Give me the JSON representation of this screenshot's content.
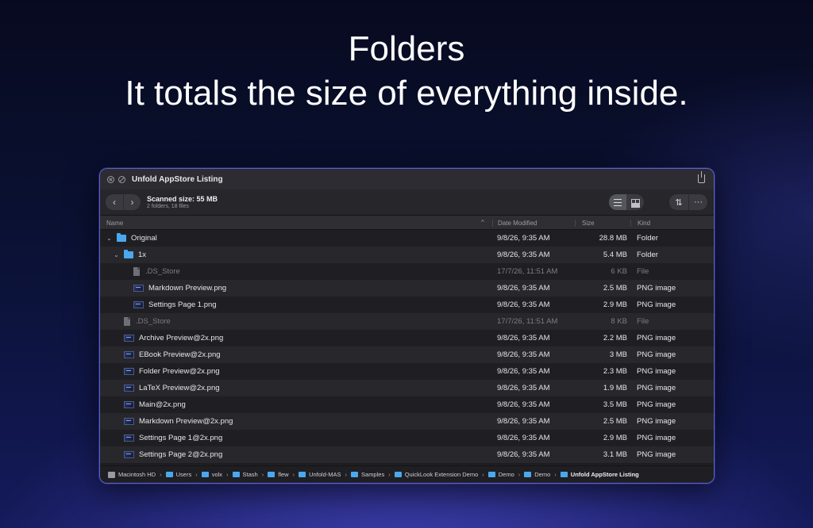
{
  "hero": {
    "line1": "Folders",
    "line2": "It totals the size of everything inside."
  },
  "window": {
    "title": "Unfold AppStore Listing",
    "scanned_size": "Scanned size: 55 MB",
    "scan_summary": "2 folders, 18 files",
    "back_glyph": "‹",
    "forward_glyph": "›",
    "sort_glyph": "⇅",
    "more_glyph": "···"
  },
  "columns": {
    "name": "Name",
    "date": "Date Modified",
    "size": "Size",
    "kind": "Kind",
    "sort_indicator": "^"
  },
  "rows": [
    {
      "name": "Original",
      "date": "9/8/26, 9:35 AM",
      "size": "28.8 MB",
      "kind": "Folder",
      "icon": "folder",
      "level": 0,
      "expanded": true
    },
    {
      "name": "1x",
      "date": "9/8/26, 9:35 AM",
      "size": "5.4 MB",
      "kind": "Folder",
      "icon": "folder",
      "level": 1,
      "expanded": true
    },
    {
      "name": ".DS_Store",
      "date": "17/7/26, 11:51 AM",
      "size": "6 KB",
      "kind": "File",
      "icon": "file",
      "level": 2,
      "dim": true
    },
    {
      "name": "Markdown Preview.png",
      "date": "9/8/26, 9:35 AM",
      "size": "2.5 MB",
      "kind": "PNG image",
      "icon": "image",
      "level": 2
    },
    {
      "name": "Settings Page 1.png",
      "date": "9/8/26, 9:35 AM",
      "size": "2.9 MB",
      "kind": "PNG image",
      "icon": "image",
      "level": 2
    },
    {
      "name": ".DS_Store",
      "date": "17/7/26, 11:51 AM",
      "size": "8 KB",
      "kind": "File",
      "icon": "file",
      "level": 1,
      "dim": true
    },
    {
      "name": "Archive Preview@2x.png",
      "date": "9/8/26, 9:35 AM",
      "size": "2.2 MB",
      "kind": "PNG image",
      "icon": "image",
      "level": 1
    },
    {
      "name": "EBook Preview@2x.png",
      "date": "9/8/26, 9:35 AM",
      "size": "3 MB",
      "kind": "PNG image",
      "icon": "image",
      "level": 1
    },
    {
      "name": "Folder Preview@2x.png",
      "date": "9/8/26, 9:35 AM",
      "size": "2.3 MB",
      "kind": "PNG image",
      "icon": "image",
      "level": 1
    },
    {
      "name": "LaTeX Preview@2x.png",
      "date": "9/8/26, 9:35 AM",
      "size": "1.9 MB",
      "kind": "PNG image",
      "icon": "image",
      "level": 1
    },
    {
      "name": "Main@2x.png",
      "date": "9/8/26, 9:35 AM",
      "size": "3.5 MB",
      "kind": "PNG image",
      "icon": "image",
      "level": 1
    },
    {
      "name": "Markdown Preview@2x.png",
      "date": "9/8/26, 9:35 AM",
      "size": "2.5 MB",
      "kind": "PNG image",
      "icon": "image",
      "level": 1
    },
    {
      "name": "Settings Page 1@2x.png",
      "date": "9/8/26, 9:35 AM",
      "size": "2.9 MB",
      "kind": "PNG image",
      "icon": "image",
      "level": 1
    },
    {
      "name": "Settings Page 2@2x.png",
      "date": "9/8/26, 9:35 AM",
      "size": "3.1 MB",
      "kind": "PNG image",
      "icon": "image",
      "level": 1
    }
  ],
  "breadcrumbs": [
    {
      "label": "Macintosh HD",
      "icon": "disk"
    },
    {
      "label": "Users",
      "icon": "folder"
    },
    {
      "label": "volx",
      "icon": "folder"
    },
    {
      "label": "Stash",
      "icon": "folder"
    },
    {
      "label": "flew",
      "icon": "folder"
    },
    {
      "label": "Unfold-MAS",
      "icon": "folder"
    },
    {
      "label": "Samples",
      "icon": "folder"
    },
    {
      "label": "QuickLook Extension Demo",
      "icon": "folder"
    },
    {
      "label": "Demo",
      "icon": "folder"
    },
    {
      "label": "Demo",
      "icon": "folder"
    },
    {
      "label": "Unfold AppStore Listing",
      "icon": "folder"
    }
  ],
  "colors": {
    "accent_border": "#5a5fd0",
    "folder": "#4aa8ef",
    "window_bg": "#1e1e22"
  }
}
